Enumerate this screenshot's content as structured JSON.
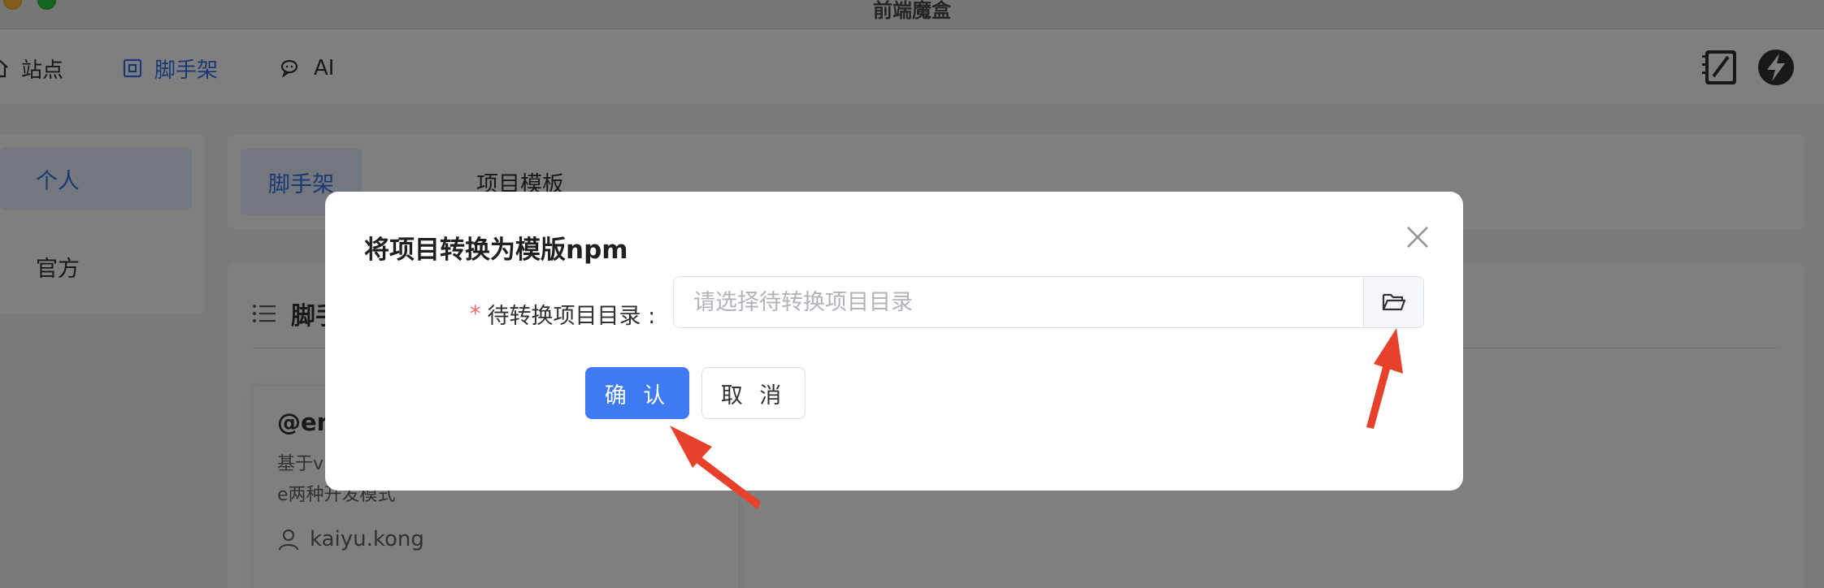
{
  "window": {
    "title": "前端魔盒"
  },
  "topnav": {
    "items": [
      {
        "label": "站点",
        "icon": "home-icon",
        "active": false
      },
      {
        "label": "脚手架",
        "icon": "scaffold-icon",
        "active": true
      },
      {
        "label": "AI",
        "icon": "chat-icon",
        "active": false
      }
    ],
    "right_icons": [
      "notebook-icon",
      "lightning-icon"
    ]
  },
  "sidenav": {
    "items": [
      {
        "label": "个人",
        "active": true
      },
      {
        "label": "官方",
        "active": false
      }
    ]
  },
  "tabs": [
    {
      "label": "脚手架",
      "active": true
    },
    {
      "label": "项目模板",
      "active": false
    }
  ],
  "panel": {
    "title": "脚手",
    "card": {
      "title": "@en",
      "desc_line1": "基于v",
      "desc_line2": "e两种开发模式",
      "author": "kaiyu.kong"
    }
  },
  "dialog": {
    "title": "将项目转换为模版npm",
    "field_label": "待转换项目目录 :",
    "required_mark": "*",
    "field_placeholder": "请选择待转换项目目录",
    "field_value": "",
    "confirm_label": "确 认",
    "cancel_label": "取 消"
  },
  "colors": {
    "primary": "#3e7bf2",
    "accent_nav": "#3370e8",
    "required": "#f56c6c",
    "annotation_arrow": "#e8412b"
  }
}
